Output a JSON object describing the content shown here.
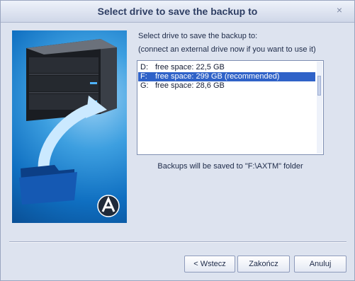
{
  "window": {
    "title": "Select drive to save the backup to",
    "close_glyph": "×"
  },
  "content": {
    "instruction_line1": "Select drive to save the backup to:",
    "instruction_line2": "(connect an external drive now if you want to use it)",
    "drives": [
      {
        "letter": "D:",
        "info": "free space: 22,5 GB",
        "selected": false
      },
      {
        "letter": "F:",
        "info": "free space: 299 GB (recommended)",
        "selected": true
      },
      {
        "letter": "G:",
        "info": "free space: 28,6 GB",
        "selected": false
      }
    ],
    "save_note": "Backups will be saved to \"F:\\AXTM\" folder"
  },
  "buttons": {
    "back_label": "< Wstecz",
    "finish_label": "Zakończ",
    "cancel_label": "Anuluj"
  },
  "icons": {
    "illustration": "external-drive-backup-illustration",
    "logo": "app-logo-icon"
  },
  "colors": {
    "selection": "#2f62c8",
    "illustration_blue": "#1a7fd0"
  }
}
